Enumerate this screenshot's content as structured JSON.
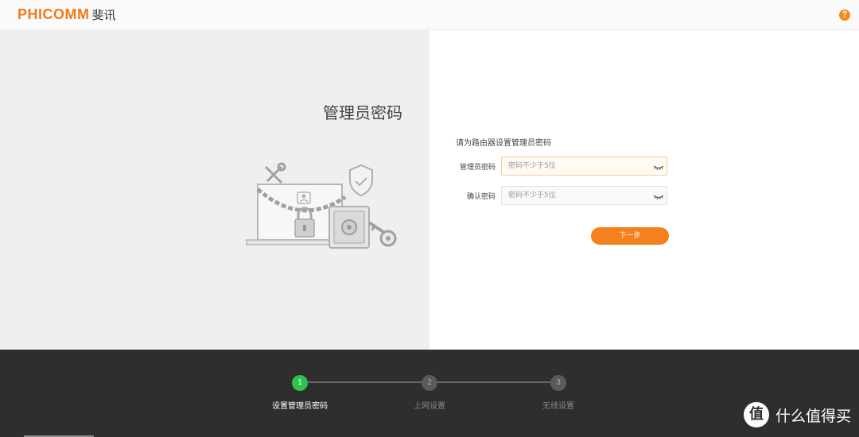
{
  "header": {
    "logo_en": "PHICOMM",
    "logo_cn": "斐讯",
    "help_icon": "question-icon",
    "help_label": "?"
  },
  "left": {
    "title": "管理员密码",
    "illustration": "router-lock-illustration"
  },
  "form": {
    "description": "请为路由器设置管理员密码",
    "admin_password_label": "管理员密码",
    "admin_password_placeholder": "密码不少于5位",
    "admin_password_value": "",
    "confirm_password_label": "确认密码",
    "confirm_password_placeholder": "密码不少于5位",
    "confirm_password_value": "",
    "eye_icon": "eye-closed-icon",
    "next_label": "下一步"
  },
  "steps": [
    {
      "number": "1",
      "label": "设置管理员密码",
      "active": true
    },
    {
      "number": "2",
      "label": "上网设置",
      "active": false
    },
    {
      "number": "3",
      "label": "无线设置",
      "active": false
    }
  ],
  "watermark": {
    "glyph": "值",
    "text": "什么值得买"
  },
  "colors": {
    "brand_orange": "#f07b18",
    "button_orange": "#f5801e",
    "step_active_green": "#2fc150",
    "footer_bg": "#2e2e2e",
    "left_panel_bg": "#efefef"
  }
}
